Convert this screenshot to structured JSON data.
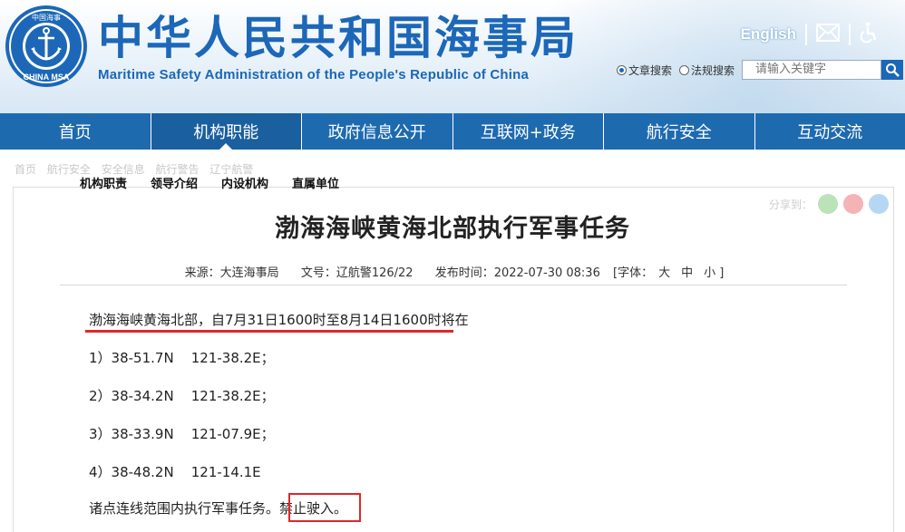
{
  "header": {
    "logo_top_text": "中国海事",
    "logo_bottom_text": "CHINA MSA",
    "title_cn": "中华人民共和国海事局",
    "title_en": "Maritime Safety Administration of the People's Republic of China",
    "english_link": "English",
    "search": {
      "radio_article": "文章搜索",
      "radio_law": "法规搜索",
      "placeholder": "请输入关键字"
    }
  },
  "nav": {
    "items": [
      "首页",
      "机构职能",
      "政府信息公开",
      "互联网+政务",
      "航行安全",
      "互动交流"
    ],
    "active_index": 1
  },
  "breadcrumb": [
    "首页",
    "航行安全",
    "安全信息",
    "航行警告",
    "辽宁航警"
  ],
  "submenu": [
    "机构职责",
    "领导介绍",
    "内设机构",
    "直属单位"
  ],
  "share_label": "分享到：",
  "article": {
    "title": "渤海海峡黄海北部执行军事任务",
    "source": "来源：大连海事局",
    "doc_no": "文号：辽航警126/22",
    "publish_time": "发布时间：2022-07-30 08:36",
    "font_label": "[字体：",
    "font_large": "大",
    "font_medium": "中",
    "font_small": "小 ]",
    "paragraphs": [
      "渤海海峡黄海北部，自7月31日1600时至8月14日1600时将在",
      "1）38-51.7N    121-38.2E；",
      "2）38-34.2N    121-38.2E；",
      "3）38-33.9N    121-07.9E；",
      "4）38-48.2N    121-14.1E",
      "诸点连线范围内执行军事任务。禁止驶入。"
    ]
  },
  "colors": {
    "brand": "#1c67b8",
    "nav_bg": "#1e6aaf",
    "highlight": "#e0262a"
  }
}
